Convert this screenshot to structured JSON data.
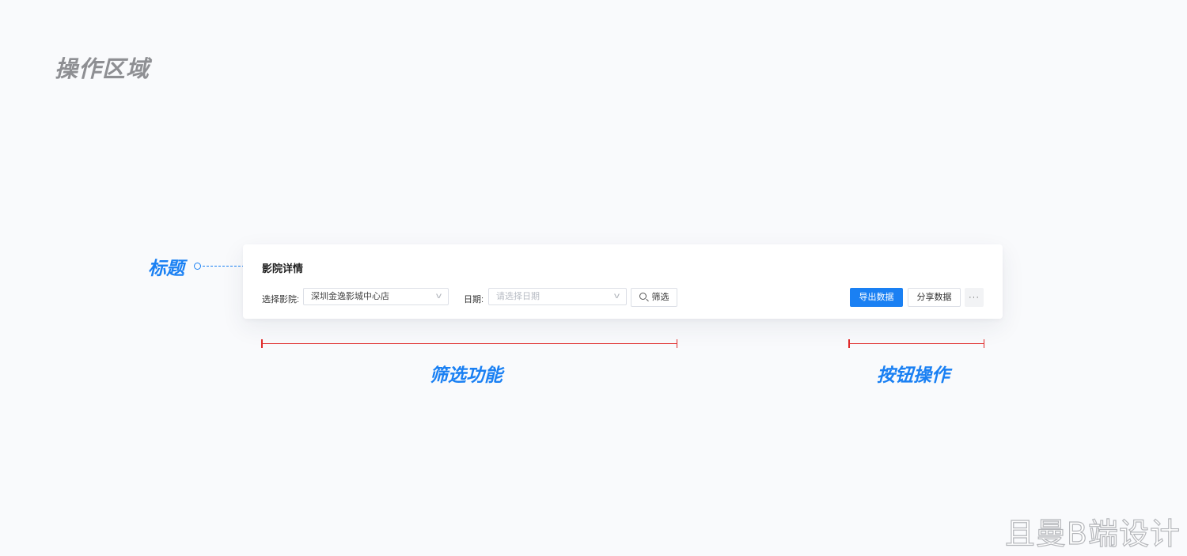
{
  "page": {
    "section_title": "操作区域",
    "watermark": "且曼B端设计"
  },
  "annotations": {
    "title_label": "标题",
    "filter_label": "筛选功能",
    "buttons_label": "按钮操作",
    "accent_color": "#1a80f3",
    "bracket_color": "#e02b2b"
  },
  "panel": {
    "title": "影院详情",
    "cinema_filter": {
      "label": "选择影院:",
      "value": "深圳金逸影城中心店",
      "icon": "chevron-down-icon"
    },
    "date_filter": {
      "label": "日期:",
      "placeholder": "请选择日期",
      "icon": "chevron-down-icon"
    },
    "filter_button": {
      "label": "筛选",
      "icon": "search-icon"
    },
    "export_button": "导出数据",
    "share_button": "分享数据",
    "more_button": "···"
  }
}
